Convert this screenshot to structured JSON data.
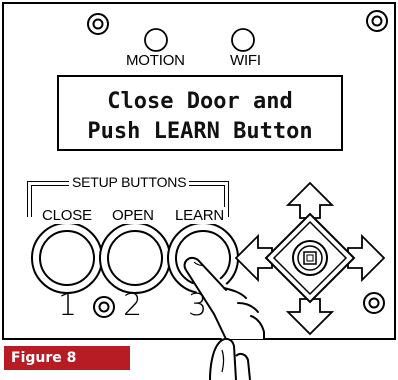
{
  "indicators": {
    "motion_label": "MOTION",
    "wifi_label": "WIFI"
  },
  "display": {
    "line1": "Close Door and",
    "line2": "Push LEARN Button"
  },
  "setup": {
    "group_label": "SETUP BUTTONS",
    "buttons": [
      {
        "label": "CLOSE",
        "number": "1"
      },
      {
        "label": "OPEN",
        "number": "2"
      },
      {
        "label": "LEARN",
        "number": "3"
      }
    ]
  },
  "caption": {
    "label": "Figure 8",
    "color": "#b71c24"
  },
  "icons": [
    "screw-icon",
    "led-icon",
    "directional-pad-icon",
    "hand-pointer-icon"
  ]
}
